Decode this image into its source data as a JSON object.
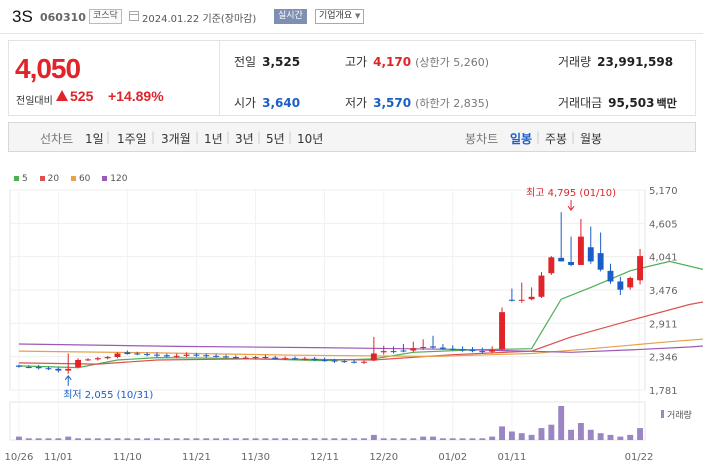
{
  "header": {
    "stock_name": "3S",
    "stock_code": "060310",
    "market": "코스닥",
    "date": "2024.01.22",
    "basis": "기준(장마감)",
    "realtime": "실시간",
    "company_info": "기업개요",
    "dropdown_icon": "caret-down-icon"
  },
  "price": {
    "current": "4,050",
    "change_label": "전일대비",
    "change": "525",
    "change_pct": "+14.89%",
    "color_up": "#e0242a",
    "color_down": "#1a5fc8",
    "prev_close_label": "전일",
    "prev_close": "3,525",
    "open_label": "시가",
    "open": "3,640",
    "high_label": "고가",
    "high": "4,170",
    "upper_limit": "(상한가 5,260)",
    "low_label": "저가",
    "low": "3,570",
    "lower_limit": "(하한가 2,835)",
    "volume_label": "거래량",
    "volume": "23,991,598",
    "amount_label": "거래대금",
    "amount": "95,503",
    "amount_unit": "백만"
  },
  "toolbar": {
    "line_chart_label": "선차트",
    "periods": [
      "1일",
      "1주일",
      "3개월",
      "1년",
      "3년",
      "5년",
      "10년"
    ],
    "candle_label": "봉차트",
    "candles": [
      "일봉",
      "주봉",
      "월봉"
    ],
    "active_candle": "일봉"
  },
  "chart_data": {
    "type": "candlestick",
    "legend": [
      {
        "name": "5",
        "color": "#4caf50"
      },
      {
        "name": "20",
        "color": "#d9534f"
      },
      {
        "name": "60",
        "color": "#e8a04a"
      },
      {
        "name": "120",
        "color": "#9b59b6"
      }
    ],
    "y_ticks": [
      "5,170",
      "4,605",
      "4,041",
      "3,476",
      "2,911",
      "2,346",
      "1,781"
    ],
    "ylim": [
      1781,
      5170
    ],
    "x_ticks": [
      "10/26",
      "11/01",
      "11/10",
      "11/21",
      "11/30",
      "12/11",
      "12/20",
      "01/02",
      "01/11",
      "01/22"
    ],
    "high_annotation": "최고 4,795 (01/10)",
    "low_annotation": "최저 2,055 (10/31)",
    "volume_label": "거래량",
    "candles": [
      {
        "o": 2195,
        "h": 2210,
        "l": 2160,
        "c": 2175
      },
      {
        "o": 2170,
        "h": 2200,
        "l": 2150,
        "c": 2165
      },
      {
        "o": 2170,
        "h": 2205,
        "l": 2130,
        "c": 2150
      },
      {
        "o": 2150,
        "h": 2175,
        "l": 2120,
        "c": 2140
      },
      {
        "o": 2140,
        "h": 2165,
        "l": 2080,
        "c": 2110
      },
      {
        "o": 2110,
        "h": 2400,
        "l": 2055,
        "c": 2140
      },
      {
        "o": 2170,
        "h": 2320,
        "l": 2150,
        "c": 2290
      },
      {
        "o": 2300,
        "h": 2320,
        "l": 2270,
        "c": 2300
      },
      {
        "o": 2300,
        "h": 2340,
        "l": 2280,
        "c": 2320
      },
      {
        "o": 2320,
        "h": 2360,
        "l": 2300,
        "c": 2340
      },
      {
        "o": 2340,
        "h": 2420,
        "l": 2320,
        "c": 2400
      },
      {
        "o": 2420,
        "h": 2450,
        "l": 2380,
        "c": 2390
      },
      {
        "o": 2400,
        "h": 2430,
        "l": 2370,
        "c": 2390
      },
      {
        "o": 2390,
        "h": 2420,
        "l": 2350,
        "c": 2380
      },
      {
        "o": 2380,
        "h": 2420,
        "l": 2330,
        "c": 2370
      },
      {
        "o": 2370,
        "h": 2400,
        "l": 2330,
        "c": 2350
      },
      {
        "o": 2350,
        "h": 2400,
        "l": 2320,
        "c": 2360
      },
      {
        "o": 2360,
        "h": 2420,
        "l": 2340,
        "c": 2380
      },
      {
        "o": 2380,
        "h": 2410,
        "l": 2340,
        "c": 2370
      },
      {
        "o": 2370,
        "h": 2400,
        "l": 2330,
        "c": 2360
      },
      {
        "o": 2360,
        "h": 2390,
        "l": 2330,
        "c": 2350
      },
      {
        "o": 2350,
        "h": 2380,
        "l": 2320,
        "c": 2340
      },
      {
        "o": 2340,
        "h": 2370,
        "l": 2310,
        "c": 2320
      },
      {
        "o": 2320,
        "h": 2360,
        "l": 2300,
        "c": 2330
      },
      {
        "o": 2330,
        "h": 2360,
        "l": 2300,
        "c": 2340
      },
      {
        "o": 2340,
        "h": 2380,
        "l": 2310,
        "c": 2330
      },
      {
        "o": 2330,
        "h": 2360,
        "l": 2300,
        "c": 2310
      },
      {
        "o": 2310,
        "h": 2350,
        "l": 2290,
        "c": 2320
      },
      {
        "o": 2320,
        "h": 2350,
        "l": 2290,
        "c": 2300
      },
      {
        "o": 2300,
        "h": 2340,
        "l": 2280,
        "c": 2310
      },
      {
        "o": 2310,
        "h": 2340,
        "l": 2270,
        "c": 2290
      },
      {
        "o": 2290,
        "h": 2330,
        "l": 2260,
        "c": 2280
      },
      {
        "o": 2280,
        "h": 2310,
        "l": 2240,
        "c": 2270
      },
      {
        "o": 2270,
        "h": 2300,
        "l": 2240,
        "c": 2260
      },
      {
        "o": 2260,
        "h": 2290,
        "l": 2230,
        "c": 2250
      },
      {
        "o": 2250,
        "h": 2280,
        "l": 2220,
        "c": 2260
      },
      {
        "o": 2280,
        "h": 2680,
        "l": 2270,
        "c": 2400
      },
      {
        "o": 2420,
        "h": 2530,
        "l": 2380,
        "c": 2440
      },
      {
        "o": 2440,
        "h": 2520,
        "l": 2400,
        "c": 2430
      },
      {
        "o": 2450,
        "h": 2560,
        "l": 2420,
        "c": 2440
      },
      {
        "o": 2450,
        "h": 2600,
        "l": 2420,
        "c": 2490
      },
      {
        "o": 2500,
        "h": 2640,
        "l": 2460,
        "c": 2510
      },
      {
        "o": 2520,
        "h": 2700,
        "l": 2480,
        "c": 2500
      },
      {
        "o": 2500,
        "h": 2560,
        "l": 2460,
        "c": 2480
      },
      {
        "o": 2480,
        "h": 2540,
        "l": 2450,
        "c": 2470
      },
      {
        "o": 2470,
        "h": 2520,
        "l": 2430,
        "c": 2460
      },
      {
        "o": 2460,
        "h": 2510,
        "l": 2420,
        "c": 2440
      },
      {
        "o": 2440,
        "h": 2500,
        "l": 2400,
        "c": 2430
      },
      {
        "o": 2430,
        "h": 2520,
        "l": 2400,
        "c": 2460
      },
      {
        "o": 2470,
        "h": 3180,
        "l": 2460,
        "c": 3100
      },
      {
        "o": 3310,
        "h": 3500,
        "l": 3280,
        "c": 3300
      },
      {
        "o": 3300,
        "h": 3600,
        "l": 3260,
        "c": 3310
      },
      {
        "o": 3320,
        "h": 3520,
        "l": 3300,
        "c": 3360
      },
      {
        "o": 3360,
        "h": 3780,
        "l": 3340,
        "c": 3720
      },
      {
        "o": 3760,
        "h": 4050,
        "l": 3730,
        "c": 4030
      },
      {
        "o": 4020,
        "h": 4795,
        "l": 3960,
        "c": 3960
      },
      {
        "o": 3950,
        "h": 4380,
        "l": 3880,
        "c": 3900
      },
      {
        "o": 3900,
        "h": 4680,
        "l": 3900,
        "c": 4380
      },
      {
        "o": 4200,
        "h": 4550,
        "l": 3920,
        "c": 3960
      },
      {
        "o": 4100,
        "h": 4450,
        "l": 3790,
        "c": 3820
      },
      {
        "o": 3800,
        "h": 3920,
        "l": 3580,
        "c": 3620
      },
      {
        "o": 3620,
        "h": 3700,
        "l": 3390,
        "c": 3480
      },
      {
        "o": 3520,
        "h": 3700,
        "l": 3480,
        "c": 3680
      },
      {
        "o": 3640,
        "h": 4170,
        "l": 3570,
        "c": 4050
      }
    ],
    "volume": [
      2,
      1,
      1,
      1,
      1,
      2,
      1,
      1,
      1,
      1,
      1,
      1,
      1,
      1,
      1,
      1,
      1,
      1,
      1,
      1,
      1,
      1,
      1,
      1,
      1,
      1,
      1,
      1,
      1,
      1,
      1,
      1,
      1,
      1,
      1,
      1,
      3,
      1,
      1,
      1,
      1,
      2,
      2,
      1,
      1,
      1,
      1,
      1,
      2,
      8,
      5,
      4,
      3,
      7,
      9,
      20,
      6,
      10,
      6,
      4,
      3,
      2,
      3,
      7
    ],
    "volume_max": 20,
    "ma": {
      "5": [
        [
          0,
          2190
        ],
        [
          6,
          2160
        ],
        [
          10,
          2290
        ],
        [
          14,
          2330
        ],
        [
          20,
          2320
        ],
        [
          26,
          2300
        ],
        [
          31,
          2280
        ],
        [
          36,
          2310
        ],
        [
          40,
          2420
        ],
        [
          46,
          2460
        ],
        [
          52,
          2480
        ],
        [
          55,
          3320
        ],
        [
          58,
          3520
        ],
        [
          62,
          3800
        ],
        [
          66,
          3960
        ],
        [
          70,
          3800
        ],
        [
          73,
          3600
        ]
      ],
      "20": [
        [
          0,
          2240
        ],
        [
          8,
          2220
        ],
        [
          14,
          2290
        ],
        [
          24,
          2310
        ],
        [
          36,
          2290
        ],
        [
          44,
          2380
        ],
        [
          52,
          2440
        ],
        [
          56,
          2680
        ],
        [
          62,
          2960
        ],
        [
          68,
          3230
        ],
        [
          73,
          3380
        ]
      ],
      "60": [
        [
          0,
          2440
        ],
        [
          14,
          2410
        ],
        [
          28,
          2370
        ],
        [
          42,
          2350
        ],
        [
          52,
          2400
        ],
        [
          58,
          2480
        ],
        [
          66,
          2600
        ],
        [
          73,
          2690
        ]
      ],
      "120": [
        [
          0,
          2560
        ],
        [
          16,
          2520
        ],
        [
          30,
          2500
        ],
        [
          44,
          2470
        ],
        [
          56,
          2420
        ],
        [
          62,
          2460
        ],
        [
          68,
          2510
        ],
        [
          73,
          2570
        ]
      ]
    }
  }
}
